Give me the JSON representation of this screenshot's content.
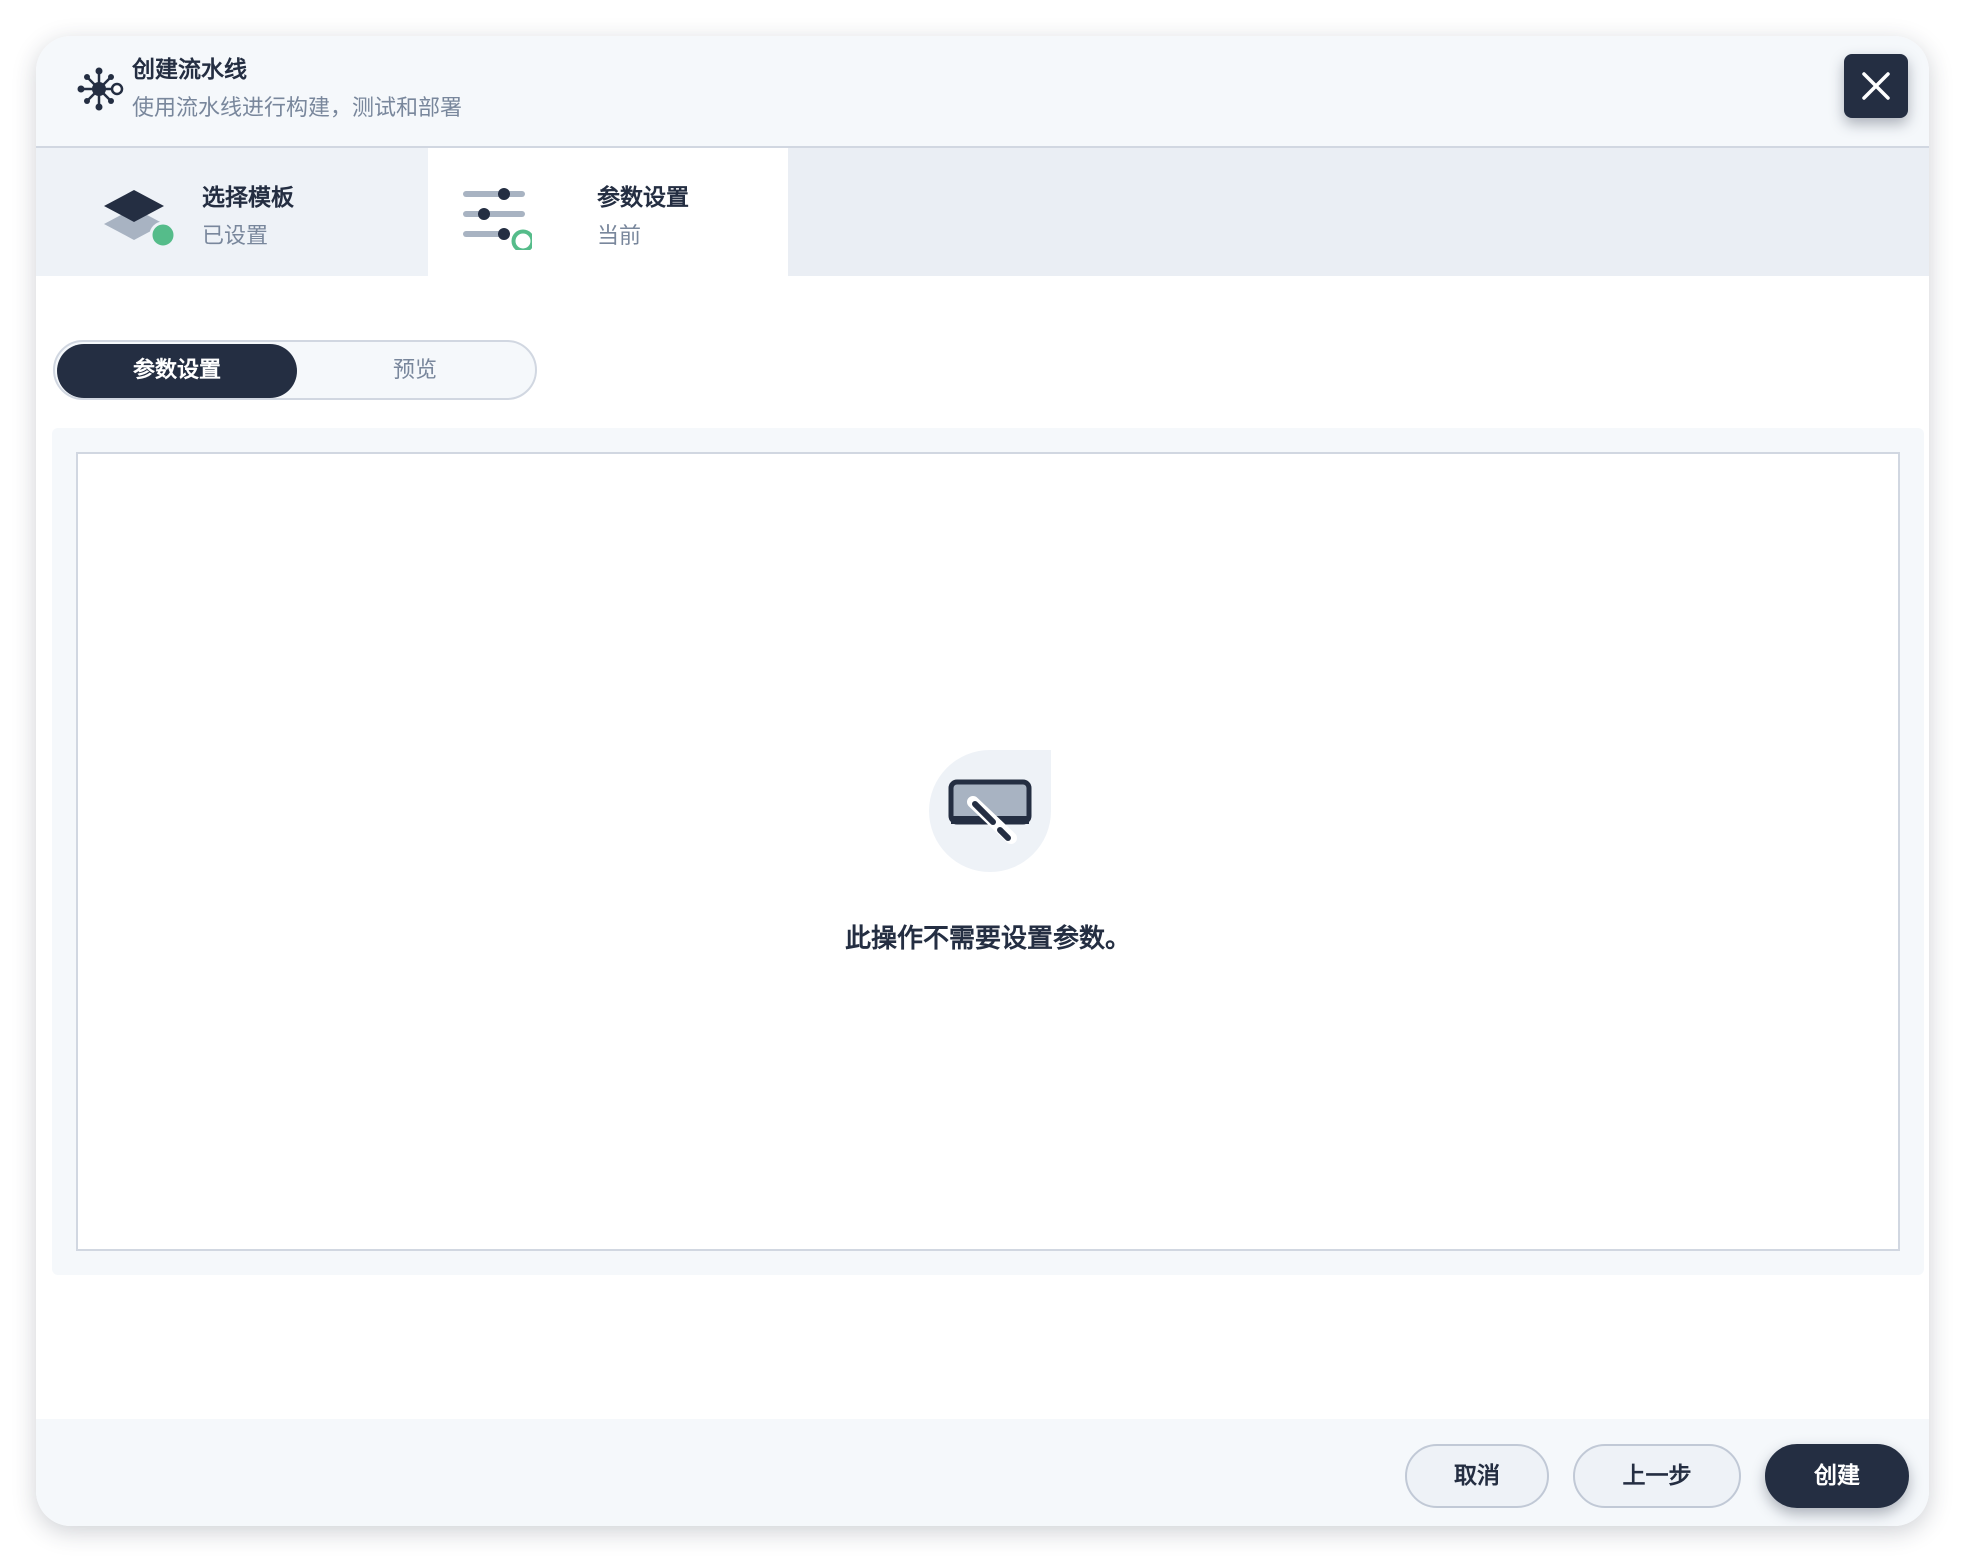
{
  "header": {
    "title": "创建流水线",
    "description": "使用流水线进行构建，测试和部署",
    "icon": "pipeline-icon",
    "close_icon": "close-icon"
  },
  "steps": [
    {
      "title": "选择模板",
      "status": "已设置",
      "icon": "layers-icon",
      "state": "done"
    },
    {
      "title": "参数设置",
      "status": "当前",
      "icon": "sliders-icon",
      "state": "current"
    }
  ],
  "tabs": [
    {
      "label": "参数设置",
      "active": true
    },
    {
      "label": "预览",
      "active": false
    }
  ],
  "empty_state": {
    "icon": "no-params-icon",
    "message": "此操作不需要设置参数。"
  },
  "footer": {
    "cancel_label": "取消",
    "prev_label": "上一步",
    "create_label": "创建"
  },
  "colors": {
    "primary": "#242e42",
    "muted_text": "#79879c",
    "success": "#55bc8a",
    "header_bg": "#f5f8fb",
    "border": "#d1d7e1"
  }
}
